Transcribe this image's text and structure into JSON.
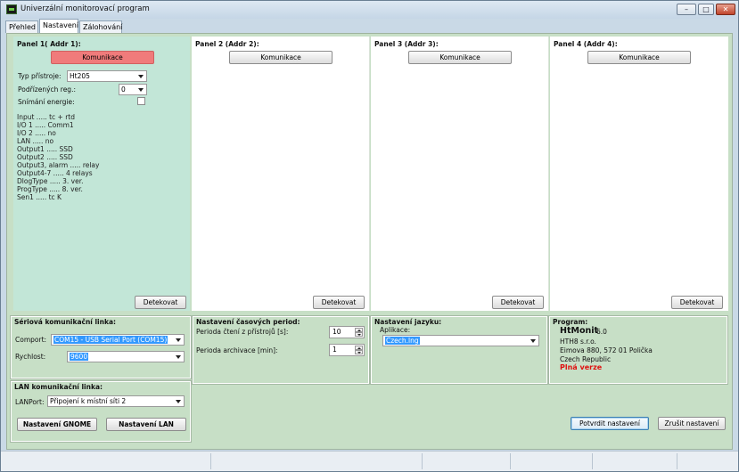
{
  "window": {
    "title": "Univerzální monitorovací program",
    "controls": [
      "minimize",
      "maximize",
      "close"
    ]
  },
  "tabs": [
    {
      "label": "Přehled",
      "active": false
    },
    {
      "label": "Nastavení",
      "active": true
    },
    {
      "label": "Zálohování",
      "active": false
    }
  ],
  "panels": [
    {
      "title": "Panel 1( Addr 1):",
      "comm_button": "Komunikace",
      "device_type_label": "Typ přístroje:",
      "device_type_value": "Ht205",
      "sub_reg_label": "Podřízených reg.:",
      "sub_reg_value": "0",
      "energy_label": "Snímání energie:",
      "energy_checked": false,
      "info": [
        "Input ..... tc + rtd",
        "I/O 1 ..... Comm1",
        "I/O 2 ..... no",
        "LAN ..... no",
        "Output1 ..... SSD",
        "Output2 ..... SSD",
        "Output3, alarm ..... relay",
        "Output4-7 ..... 4 relays",
        "DlogType ..... 3. ver.",
        "ProgType ..... 8. ver.",
        "Sen1 ..... tc K"
      ],
      "detect_button": "Detekovat",
      "accent": "#f07b7b"
    },
    {
      "title": "Panel 2 (Addr 2):",
      "comm_button": "Komunikace",
      "detect_button": "Detekovat"
    },
    {
      "title": "Panel 3 (Addr 3):",
      "comm_button": "Komunikace",
      "detect_button": "Detekovat"
    },
    {
      "title": "Panel 4 (Addr 4):",
      "comm_button": "Komunikace",
      "detect_button": "Detekovat"
    }
  ],
  "serial": {
    "title": "Sériová komunikační linka:",
    "comport_label": "Comport:",
    "comport_value": "COM15 - USB Serial Port (COM15)",
    "speed_label": "Rychlost:",
    "speed_value": "9600"
  },
  "lan": {
    "title": "LAN komunikační linka:",
    "port_label": "LANPort:",
    "port_value": "Připojení k místní síti 2",
    "gnome_button": "Nastavení GNOME",
    "lan_button": "Nastavení LAN"
  },
  "timing": {
    "title": "Nastavení časových period:",
    "read_label": "Perioda čtení z přístrojů [s]:",
    "read_value": "10",
    "archive_label": "Perioda archivace [min]:",
    "archive_value": "1"
  },
  "language": {
    "title": "Nastavení jazyku:",
    "app_label": "Aplikace:",
    "app_value": "Czech.lng"
  },
  "program": {
    "title": "Program:",
    "name": "HtMonit",
    "version": "6.0",
    "company": "HTH8 s.r.o.",
    "address": "Eimova 880, 572 01 Polička",
    "country": "Czech Republic",
    "edition": "Plná verze",
    "edition_color": "#e01010"
  },
  "actions": {
    "confirm": "Potvrdit nastavení",
    "cancel": "Zrušit nastavení"
  }
}
